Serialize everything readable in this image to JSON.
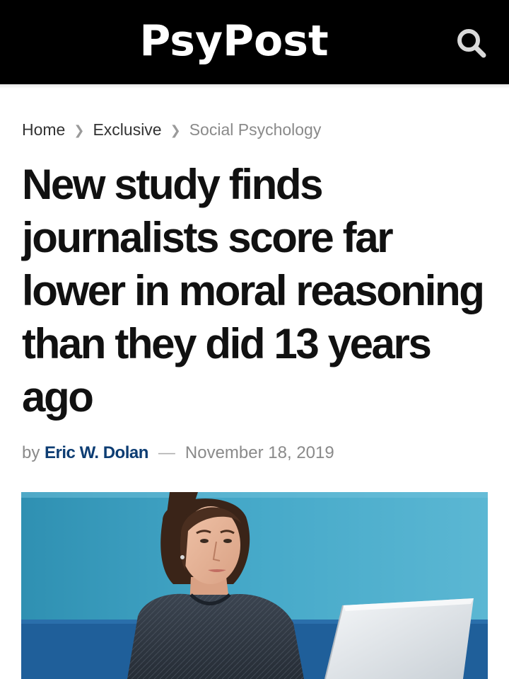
{
  "site": {
    "logo": "PsyPost",
    "search_icon": "search-icon"
  },
  "breadcrumb": {
    "items": [
      "Home",
      "Exclusive",
      "Social Psychology"
    ],
    "separator_icon": "chevron-right-icon"
  },
  "article": {
    "title": "New study finds journalists score far lower in moral reasoning than they did 13 years ago",
    "byline_prefix": "by",
    "author": "Eric W. Dolan",
    "separator": "—",
    "date": "November 18, 2019"
  },
  "colors": {
    "header_bg": "#000000",
    "author_link": "#0d3d73",
    "title_text": "#111111",
    "muted_text": "#8a8a8a",
    "photo_wall": "#3fa3c3"
  }
}
